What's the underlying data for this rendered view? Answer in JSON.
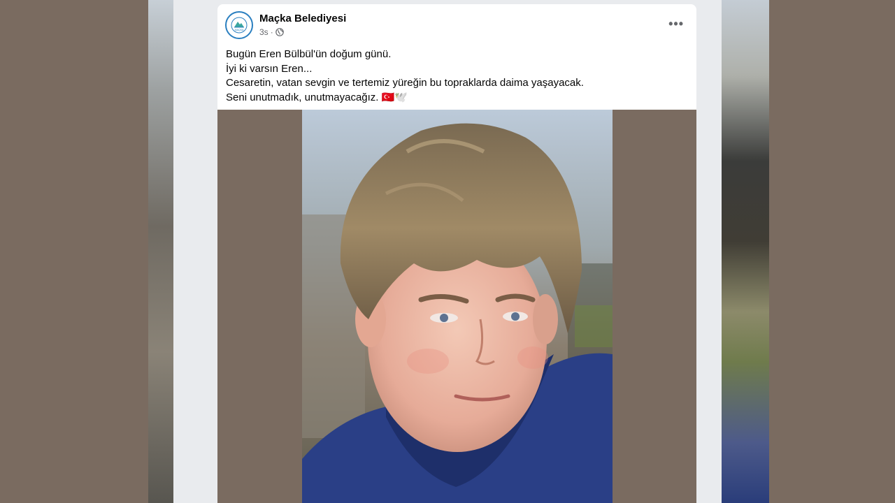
{
  "post": {
    "page_name": "Maçka Belediyesi",
    "time": "3s",
    "separator": "·",
    "privacy_icon": "globe-icon",
    "more_icon": "more-options-icon",
    "more_label": "•••",
    "logo_icon": "macka-logo-icon",
    "logo_text": "MAÇKA",
    "lines": [
      "Bugün Eren Bülbül'ün doğum günü.",
      "İyi ki varsın Eren...",
      "Cesaretin, vatan sevgin ve tertemiz yüreğin bu topraklarda daima yaşayacak.",
      "Seni unutmadık, unutmayacağız. 🇹🇷🕊️"
    ],
    "photo": "boy-portrait-photo"
  }
}
